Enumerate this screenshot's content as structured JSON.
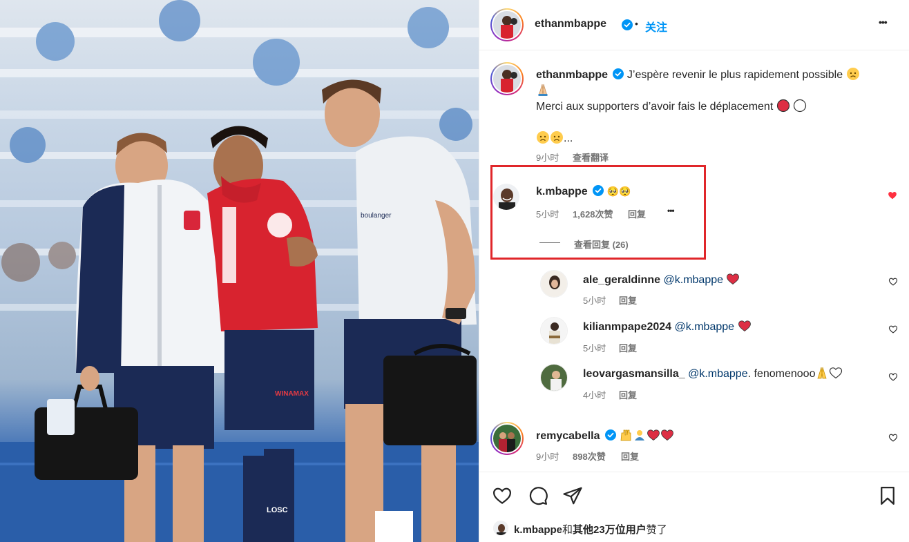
{
  "post": {
    "author": "ethanmbappe",
    "follow_label": "关注",
    "dot": "•",
    "more_label": "•••"
  },
  "caption": {
    "author": "ethanmbappe",
    "line1": "J’espère revenir le plus rapidement possible",
    "line2": "Merci aux supporters d’avoir fais le déplacement",
    "line3": "...",
    "time": "9小时",
    "translate_label": "查看翻译"
  },
  "comments": [
    {
      "user": "k.mbappe",
      "text": "🥺🥺",
      "time": "5小时",
      "likes": "1,628次赞",
      "reply_label": "回复",
      "more": "•••",
      "view_replies": "查看回复 (26)",
      "liked": true
    },
    {
      "user": "remycabella",
      "time": "9小时",
      "likes": "898次赞",
      "reply_label": "回复"
    }
  ],
  "replies": [
    {
      "user": "ale_geraldinne",
      "mention": "@k.mbappe",
      "text": "",
      "time": "5小时",
      "reply_label": "回复"
    },
    {
      "user": "kilianmpape2024",
      "mention": "@k.mbappe",
      "text": "",
      "time": "5小时",
      "reply_label": "回复"
    },
    {
      "user": "leovargasmansilla_",
      "mention": "@k.mbappe",
      "text": ". fenomenooo",
      "time": "4小时",
      "reply_label": "回复"
    }
  ],
  "likes_summary": {
    "user": "k.mbappe",
    "connector": "和",
    "others": "其他23万位用户",
    "suffix": "赞了"
  },
  "photo": {
    "shirt_text": "WINAMAX",
    "sponsor_text": "boulanger",
    "sock_text": "LOSC"
  },
  "colors": {
    "accent": "#0095f6",
    "like_red": "#ff3040",
    "highlight_red": "#e0262a"
  }
}
